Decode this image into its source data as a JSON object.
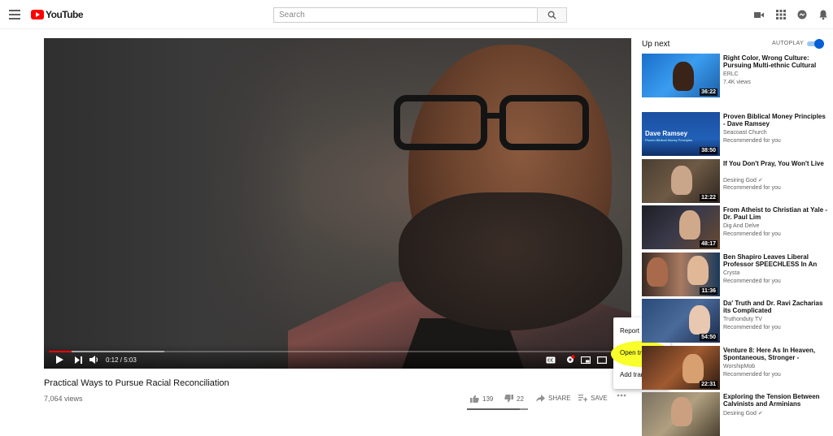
{
  "header": {
    "logo_text": "YouTube",
    "search_placeholder": "Search",
    "icons": [
      "menu-icon",
      "search-icon",
      "video-camera-icon",
      "apps-grid-icon",
      "messages-icon",
      "bell-icon"
    ]
  },
  "player": {
    "current_time": "0:12",
    "duration": "5:03",
    "time_display": "0:12 / 5:03",
    "played_fraction": 0.04,
    "loaded_fraction": 0.2,
    "accent_color": "#ff0000"
  },
  "video": {
    "title": "Practical Ways to Pursue Racial Reconciliation",
    "views": "7,064 views",
    "likes": "139",
    "dislikes": "22",
    "share_label": "SHARE",
    "save_label": "SAVE",
    "like_ratio": 0.86
  },
  "overflow_menu": {
    "items": [
      "Report",
      "Open transcript",
      "Add translations"
    ],
    "highlight_color": "#f8ff2a"
  },
  "sidebar": {
    "up_next_label": "Up next",
    "autoplay_label": "AUTOPLAY",
    "autoplay_on": true,
    "items": [
      {
        "title": "Right Color, Wrong Culture: Pursuing Multi-ethnic Cultural",
        "channel": "ERLC",
        "meta": "7.4K views",
        "duration": "36:22"
      },
      {
        "title": "Proven Biblical Money Principles - Dave Ramsey",
        "channel": "Seacoast Church",
        "meta": "Recommended for you",
        "duration": "38:50",
        "thumb_text": "Dave Ramsey",
        "thumb_sub": "Proven Biblical Money Principles"
      },
      {
        "title": "If You Don't Pray, You Won't Live",
        "channel": "Desiring God",
        "meta": "Recommended for you",
        "duration": "12:22"
      },
      {
        "title": "From Atheist to Christian at Yale - Dr. Paul Lim",
        "channel": "Dig And Delve",
        "meta": "Recommended for you",
        "duration": "48:17"
      },
      {
        "title": "Ben Shapiro Leaves Liberal Professor SPEECHLESS In An",
        "channel": "Crysta",
        "meta": "Recommended for you",
        "duration": "11:36"
      },
      {
        "title": "Da' Truth and Dr. Ravi Zacharias its Complicated",
        "channel": "Truthonduty TV",
        "meta": "Recommended for you",
        "duration": "54:50"
      },
      {
        "title": "Venture 8: Here As In Heaven, Spontaneous, Stronger -",
        "channel": "WorshipMob",
        "meta": "Recommended for you",
        "duration": "22:31"
      },
      {
        "title": "Exploring the Tension Between Calvinists and Arminians",
        "channel": "Desiring God",
        "meta": "",
        "duration": ""
      }
    ]
  }
}
